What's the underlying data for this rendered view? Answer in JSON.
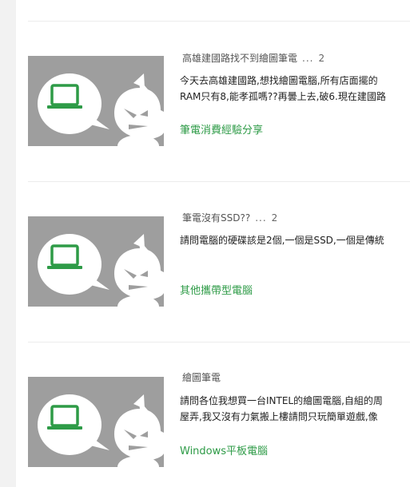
{
  "colors": {
    "thumbnail_bg": "#9e9e9e",
    "accent_green": "#2e9b47",
    "title_gray": "#555555"
  },
  "thumbnail_icon": "laptop-speech-bubble-mascot-icon",
  "posts": [
    {
      "title": "高雄建國路找不到繪圖筆電",
      "dots": "...",
      "page": "2",
      "excerpt_lines": [
        "今天去高雄建國路,想找繪圖電腦,所有店面擺的",
        "RAM只有8,能孝孤嗎??再曇上去,破6.現在建國路"
      ],
      "category": "筆電消費經驗分享"
    },
    {
      "title": "筆電沒有SSD??",
      "dots": "...",
      "page": "2",
      "excerpt_lines": [
        "請問電腦的硬碟該是2個,一個是SSD,一個是傳統"
      ],
      "category": "其他攜帶型電腦"
    },
    {
      "title": "繪圖筆電",
      "dots": "",
      "page": "",
      "excerpt_lines": [
        "請問各位我想買一台INTEL的繪圖電腦,自組的周",
        "屋弄,我又沒有力氣搬上樓請問只玩簡單遊戲,像"
      ],
      "category": "Windows平板電腦"
    }
  ]
}
